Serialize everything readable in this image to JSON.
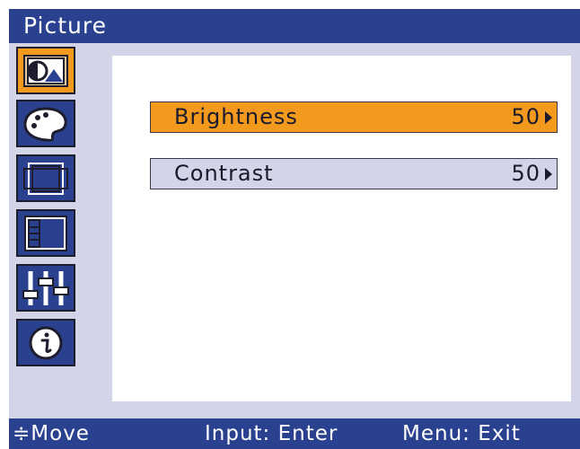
{
  "header": {
    "title": "Picture"
  },
  "sidebar": {
    "items": [
      {
        "icon": "picture-icon",
        "selected": true
      },
      {
        "icon": "color-palette-icon",
        "selected": false
      },
      {
        "icon": "geometry-icon",
        "selected": false
      },
      {
        "icon": "osd-layout-icon",
        "selected": false
      },
      {
        "icon": "settings-sliders-icon",
        "selected": false
      },
      {
        "icon": "info-icon",
        "selected": false
      }
    ]
  },
  "options": [
    {
      "label": "Brightness",
      "value": "50",
      "selected": true
    },
    {
      "label": "Contrast",
      "value": "50",
      "selected": false
    }
  ],
  "status": {
    "move": "≑Move",
    "input": "Input: Enter",
    "menu": "Menu: Exit"
  },
  "colors": {
    "bar_background": "#2a4190",
    "highlight": "#f39a1e",
    "panel": "#d4d4e8",
    "content": "#ffffff"
  }
}
